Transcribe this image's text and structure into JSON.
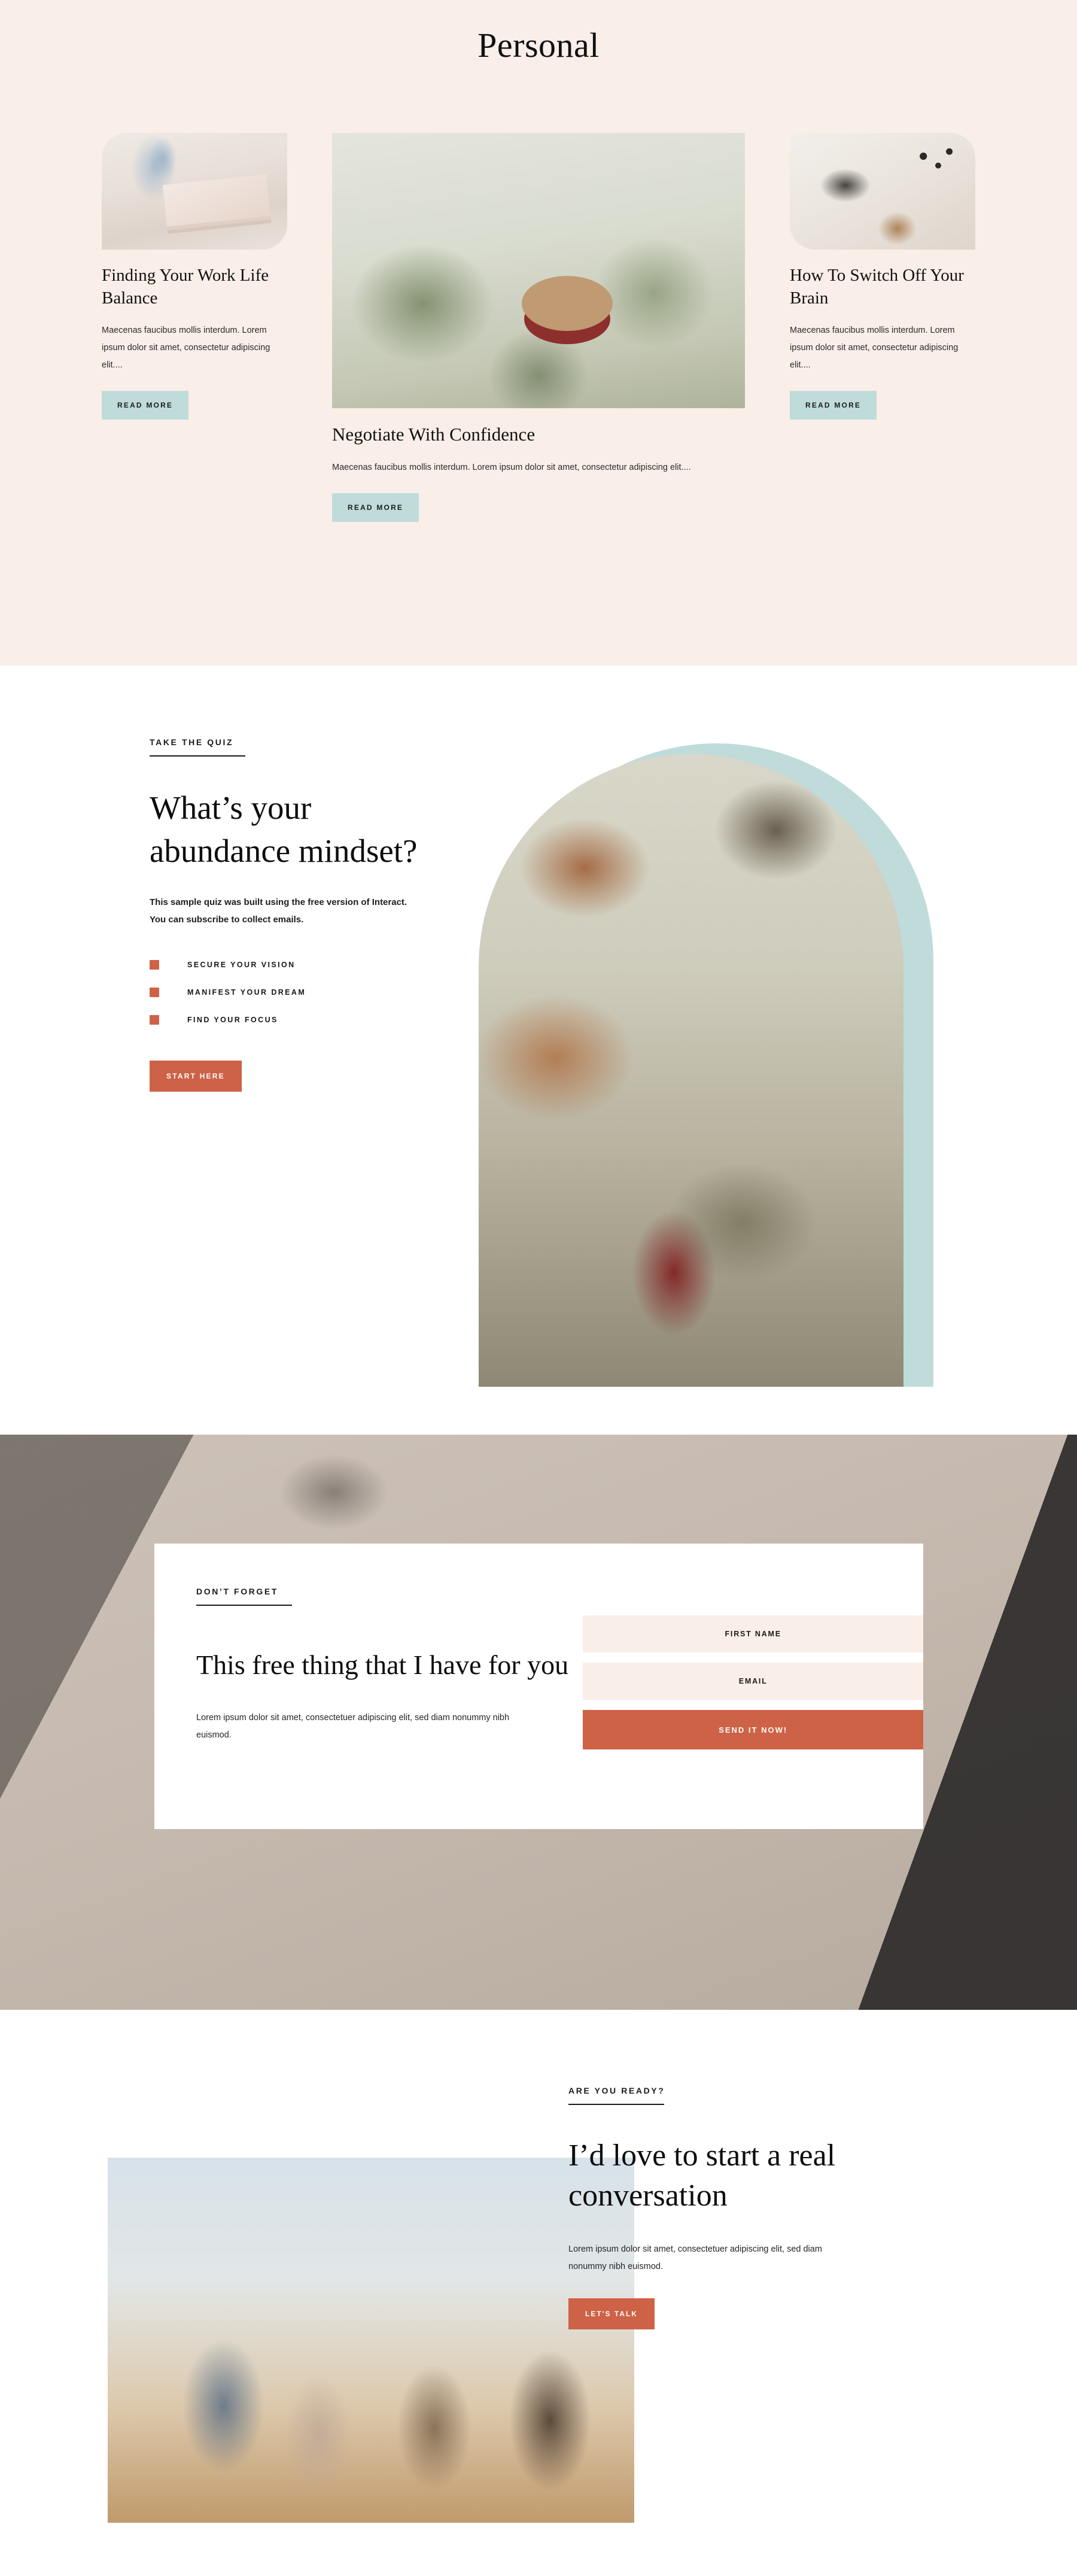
{
  "blog_section": {
    "title": "Personal",
    "bg_color": "#faeee8",
    "read_more_bg": "#bfdcdb",
    "cards": [
      {
        "image": "books-and-flowers-photo",
        "heading": "Finding Your Work Life Balance",
        "excerpt": "Maecenas faucibus mollis interdum. Lorem ipsum dolor sit amet, consectetur adipiscing elit....",
        "button": "READ MORE"
      },
      {
        "image": "woman-in-greenhouse-photo",
        "heading": "Negotiate With Confidence",
        "excerpt": "Maecenas faucibus mollis interdum. Lorem ipsum dolor sit amet, consectetur adipiscing elit....",
        "button": "READ MORE"
      },
      {
        "image": "desk-flatlay-photo",
        "heading": "How To Switch Off Your Brain",
        "excerpt": "Maecenas faucibus mollis interdum. Lorem ipsum dolor sit amet, consectetur adipiscing elit....",
        "button": "READ MORE"
      }
    ]
  },
  "quiz_section": {
    "eyebrow": "TAKE THE QUIZ",
    "heading": "What’s your abundance mindset?",
    "subtext": "This sample quiz was built using the free version of Interact. You can subscribe to collect emails.",
    "bullets": [
      "SECURE YOUR VISION",
      "MANIFEST YOUR DREAM",
      "FIND YOUR FOCUS"
    ],
    "button": "START HERE",
    "bullet_color": "#cd6247",
    "button_color": "#cd6247",
    "arch_shadow_color": "#bfdcdb",
    "image": "woman-walking-path-arch-photo"
  },
  "optin_section": {
    "eyebrow": "DON’T FORGET",
    "heading": "This free thing that I have for you",
    "paragraph": "Lorem ipsum dolor sit amet, consectetuer adipiscing elit, sed diam nonummy nibh euismod.",
    "background_image": "hands-on-keyboard-photo",
    "card_bg": "#ffffff",
    "field_bg": "#faeee8",
    "fields": [
      {
        "name": "first-name",
        "placeholder": "FIRST NAME",
        "value": ""
      },
      {
        "name": "email",
        "placeholder": "EMAIL",
        "value": ""
      }
    ],
    "submit_label": "SEND IT NOW!",
    "submit_color": "#cd6247"
  },
  "contact_section": {
    "eyebrow": "ARE YOU READY?",
    "heading": "I’d love to start a real conversation",
    "paragraph": "Lorem ipsum dolor sit amet, consectetuer adipiscing elit, sed diam nonummy nibh euismod.",
    "button": "LET'S TALK",
    "button_color": "#cd6247",
    "image": "friends-laughing-outdoors-photo",
    "accent_block_color": "#ded0b7"
  }
}
